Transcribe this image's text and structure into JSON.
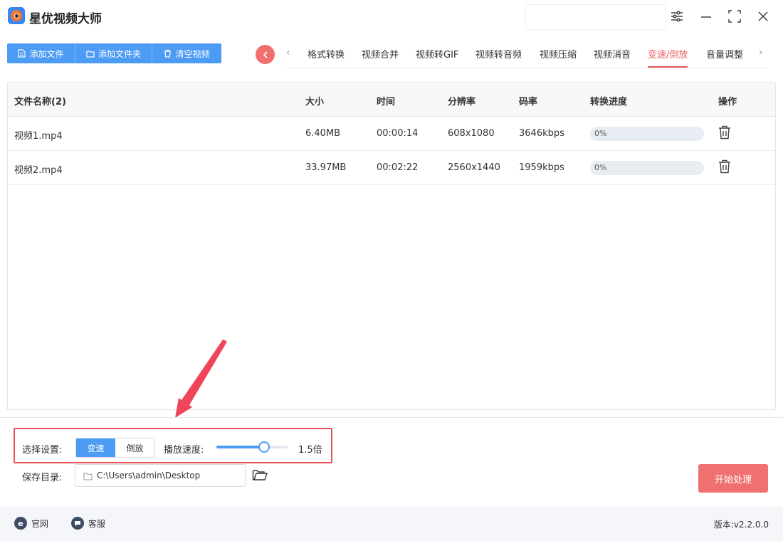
{
  "app": {
    "title": "星优视频大师"
  },
  "toolbar": {
    "add_file": "添加文件",
    "add_folder": "添加文件夹",
    "clear_videos": "清空视频"
  },
  "tabs": [
    {
      "label": "格式转换"
    },
    {
      "label": "视频合并"
    },
    {
      "label": "视频转GIF"
    },
    {
      "label": "视频转音频"
    },
    {
      "label": "视频压缩"
    },
    {
      "label": "视频消音"
    },
    {
      "label": "变速/倒放"
    },
    {
      "label": "音量调整"
    }
  ],
  "active_tab": "变速/倒放",
  "table": {
    "headers": {
      "name": "文件名称(2)",
      "size": "大小",
      "time": "时间",
      "resolution": "分辨率",
      "bitrate": "码率",
      "progress": "转换进度",
      "actions": "操作"
    },
    "rows": [
      {
        "name": "视频1.mp4",
        "size": "6.40MB",
        "time": "00:00:14",
        "resolution": "608x1080",
        "bitrate": "3646kbps",
        "progress": "0%"
      },
      {
        "name": "视频2.mp4",
        "size": "33.97MB",
        "time": "00:02:22",
        "resolution": "2560x1440",
        "bitrate": "1959kbps",
        "progress": "0%"
      }
    ]
  },
  "settings": {
    "select_label": "选择设置:",
    "mode_speed": "变速",
    "mode_reverse": "倒放",
    "selected_mode": "变速",
    "speed_label": "播放速度:",
    "speed_value": "1.5倍",
    "speed_level": 0.67,
    "save_dir_label": "保存目录:",
    "save_dir_value": "C:\\Users\\admin\\Desktop",
    "start_button": "开始处理"
  },
  "footer": {
    "website": "官网",
    "support": "客服",
    "version": "版本:v2.2.0.0"
  },
  "colors": {
    "primary_blue": "#4c9bf5",
    "accent_red": "#f07070",
    "highlight_red": "#e8525b"
  }
}
